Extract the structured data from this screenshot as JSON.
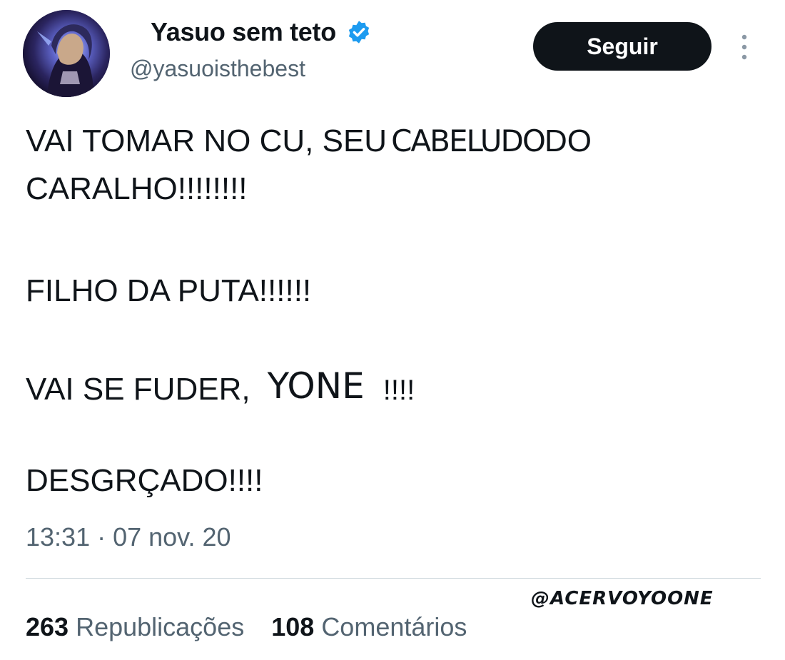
{
  "author": {
    "display_name": "Yasuo sem teto",
    "handle": "@yasuoisthebest",
    "verified_icon": "verified-badge-icon",
    "avatar": "profile-avatar"
  },
  "follow_button": {
    "label": "Seguir"
  },
  "more_menu": {
    "icon": "more-vertical-icon"
  },
  "tweet": {
    "line1_prefix": "VAI TOMAR NO CU, SEU",
    "line1_edit_word": "CABELUDO",
    "line1_suffix": "DO",
    "line2": "CARALHO!!!!!!!!",
    "line3": "FILHO DA PUTA!!!!!!",
    "line4_prefix": "VAI SE FUDER,",
    "line4_edit_name": "YONE",
    "line4_suffix": "!!!!",
    "line5": "DESGRÇADO!!!!",
    "timestamp": "13:31 · 07 nov. 20"
  },
  "watermark": "@ACERVOYOONE",
  "stats": {
    "reposts_count": "263",
    "reposts_label": "Republicações",
    "comments_count": "108",
    "comments_label": "Comentários"
  },
  "colors": {
    "text_primary": "#0f1419",
    "text_secondary": "#536471",
    "verified_blue": "#1d9bf0",
    "divider": "#cfd9de"
  }
}
